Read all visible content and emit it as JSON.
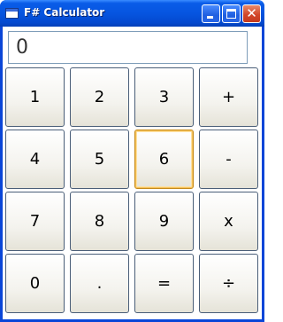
{
  "window": {
    "title": "F# Calculator",
    "icon": "app-window-icon",
    "controls": {
      "minimize_icon": "minimize-icon",
      "maximize_icon": "maximize-icon",
      "close_icon": "close-icon",
      "close_glyph": "✕"
    }
  },
  "display": {
    "value": "0"
  },
  "keypad": {
    "rows": [
      [
        {
          "label": "1"
        },
        {
          "label": "2"
        },
        {
          "label": "3"
        },
        {
          "label": "+"
        }
      ],
      [
        {
          "label": "4"
        },
        {
          "label": "5"
        },
        {
          "label": "6",
          "focused": true
        },
        {
          "label": "-"
        }
      ],
      [
        {
          "label": "7"
        },
        {
          "label": "8"
        },
        {
          "label": "9"
        },
        {
          "label": "x"
        }
      ],
      [
        {
          "label": "0"
        },
        {
          "label": "."
        },
        {
          "label": "="
        },
        {
          "label": "÷"
        }
      ]
    ]
  },
  "colors": {
    "titlebar": "#0655e0",
    "focus_border": "#c58a1a",
    "button_border": "#4a5e78"
  }
}
